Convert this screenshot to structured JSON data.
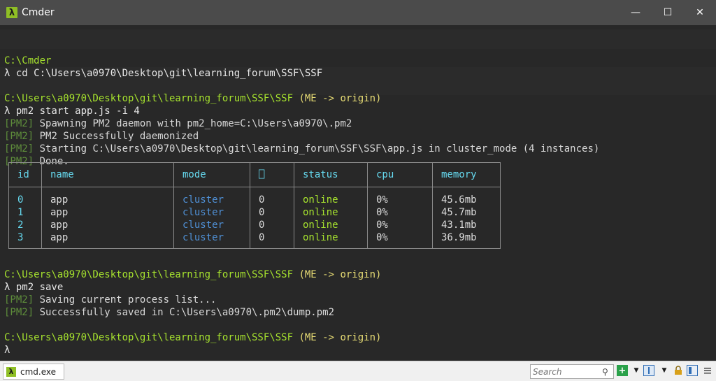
{
  "window": {
    "app_icon": "lambda-icon",
    "title": "Cmder",
    "minimize": "—",
    "maximize": "☐",
    "close": "✕"
  },
  "terminal": {
    "lines": [
      {
        "kind": "blank",
        "text": ""
      },
      {
        "kind": "path",
        "text": "C:\\Cmder"
      },
      {
        "kind": "cmd",
        "text": "λ cd C:\\Users\\a0970\\Desktop\\git\\learning_forum\\SSF\\SSF"
      },
      {
        "kind": "blank",
        "text": ""
      },
      {
        "kind": "prompt",
        "path": "C:\\Users\\a0970\\Desktop\\git\\learning_forum\\SSF\\SSF",
        "git": "(ME -> origin)"
      },
      {
        "kind": "cmd",
        "text": "λ pm2 start app.js -i 4"
      },
      {
        "kind": "pm2",
        "tag": "[PM2]",
        "text": " Spawning PM2 daemon with pm2_home=C:\\Users\\a0970\\.pm2"
      },
      {
        "kind": "pm2",
        "tag": "[PM2]",
        "text": " PM2 Successfully daemonized"
      },
      {
        "kind": "pm2",
        "tag": "[PM2]",
        "text": " Starting C:\\Users\\a0970\\Desktop\\git\\learning_forum\\SSF\\SSF\\app.js in cluster_mode (4 instances)"
      },
      {
        "kind": "pm2",
        "tag": "[PM2]",
        "text": " Done."
      }
    ],
    "lines_after": [
      {
        "kind": "prompt",
        "path": "C:\\Users\\a0970\\Desktop\\git\\learning_forum\\SSF\\SSF",
        "git": "(ME -> origin)"
      },
      {
        "kind": "cmd",
        "text": "λ pm2 save"
      },
      {
        "kind": "pm2",
        "tag": "[PM2]",
        "text": " Saving current process list..."
      },
      {
        "kind": "pm2",
        "tag": "[PM2]",
        "text": " Successfully saved in C:\\Users\\a0970\\.pm2\\dump.pm2"
      },
      {
        "kind": "blank",
        "text": ""
      },
      {
        "kind": "prompt",
        "path": "C:\\Users\\a0970\\Desktop\\git\\learning_forum\\SSF\\SSF",
        "git": "(ME -> origin)"
      },
      {
        "kind": "cmd",
        "text": "λ"
      }
    ],
    "table": {
      "headers": [
        "id",
        "name",
        "mode",
        "",
        "status",
        "cpu",
        "memory"
      ],
      "rows": [
        [
          "0",
          "app",
          "cluster",
          "0",
          "online",
          "0%",
          "45.6mb"
        ],
        [
          "1",
          "app",
          "cluster",
          "0",
          "online",
          "0%",
          "45.7mb"
        ],
        [
          "2",
          "app",
          "cluster",
          "0",
          "online",
          "0%",
          "43.1mb"
        ],
        [
          "3",
          "app",
          "cluster",
          "0",
          "online",
          "0%",
          "36.9mb"
        ]
      ]
    }
  },
  "statusbar": {
    "tab_label": "cmd.exe",
    "search_placeholder": "Search",
    "icons": [
      "new-console-icon",
      "dropdown-icon",
      "split-icon",
      "dropdown-icon",
      "lock-icon",
      "panel-icon",
      "menu-icon"
    ]
  },
  "colors": {
    "titlebar": "#4b4b4b",
    "terminal_bg": "#282828",
    "path": "#a6e22e",
    "git": "#e6db74",
    "pm2_tag": "#5e8d3b",
    "header": "#66d9ef",
    "mode": "#4f8fd4"
  }
}
